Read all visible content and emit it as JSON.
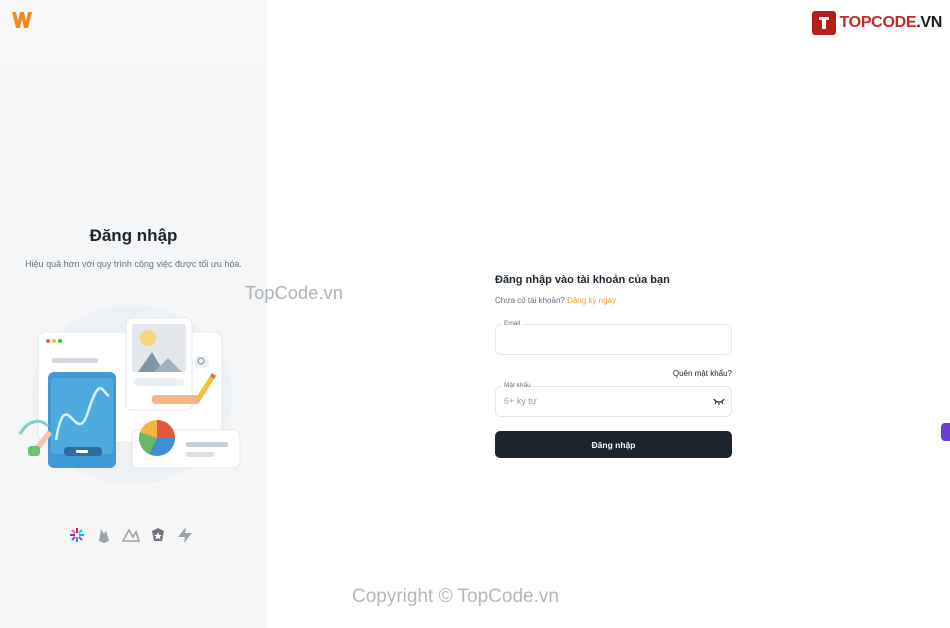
{
  "brand": {
    "logo_icon": "w-logo-icon",
    "accent": "#f08a24"
  },
  "left_panel": {
    "title": "Đăng nhập",
    "subtitle": "Hiệu quả hơn với quy trình công việc được tối ưu hóa.",
    "illustration": "dashboard-illustration",
    "brand_icons": [
      "jwt-icon",
      "firebase-icon",
      "amplify-icon",
      "auth0-icon",
      "supabase-icon"
    ]
  },
  "watermarks": {
    "site": "TopCode.vn",
    "copyright": "Copyright © TopCode.vn",
    "logo_prefix": "TOPCODE",
    "logo_suffix": ".VN"
  },
  "form": {
    "title": "Đăng nhập vào tài khoản của bạn",
    "no_account": "Chưa có tài khoản?",
    "signup_link": "Đăng ký ngay",
    "email_label": "Email",
    "email_value": "",
    "forgot": "Quên mật khẩu?",
    "password_label": "Mật khẩu",
    "password_placeholder": "6+ ký tự",
    "submit": "Đăng nhập"
  }
}
